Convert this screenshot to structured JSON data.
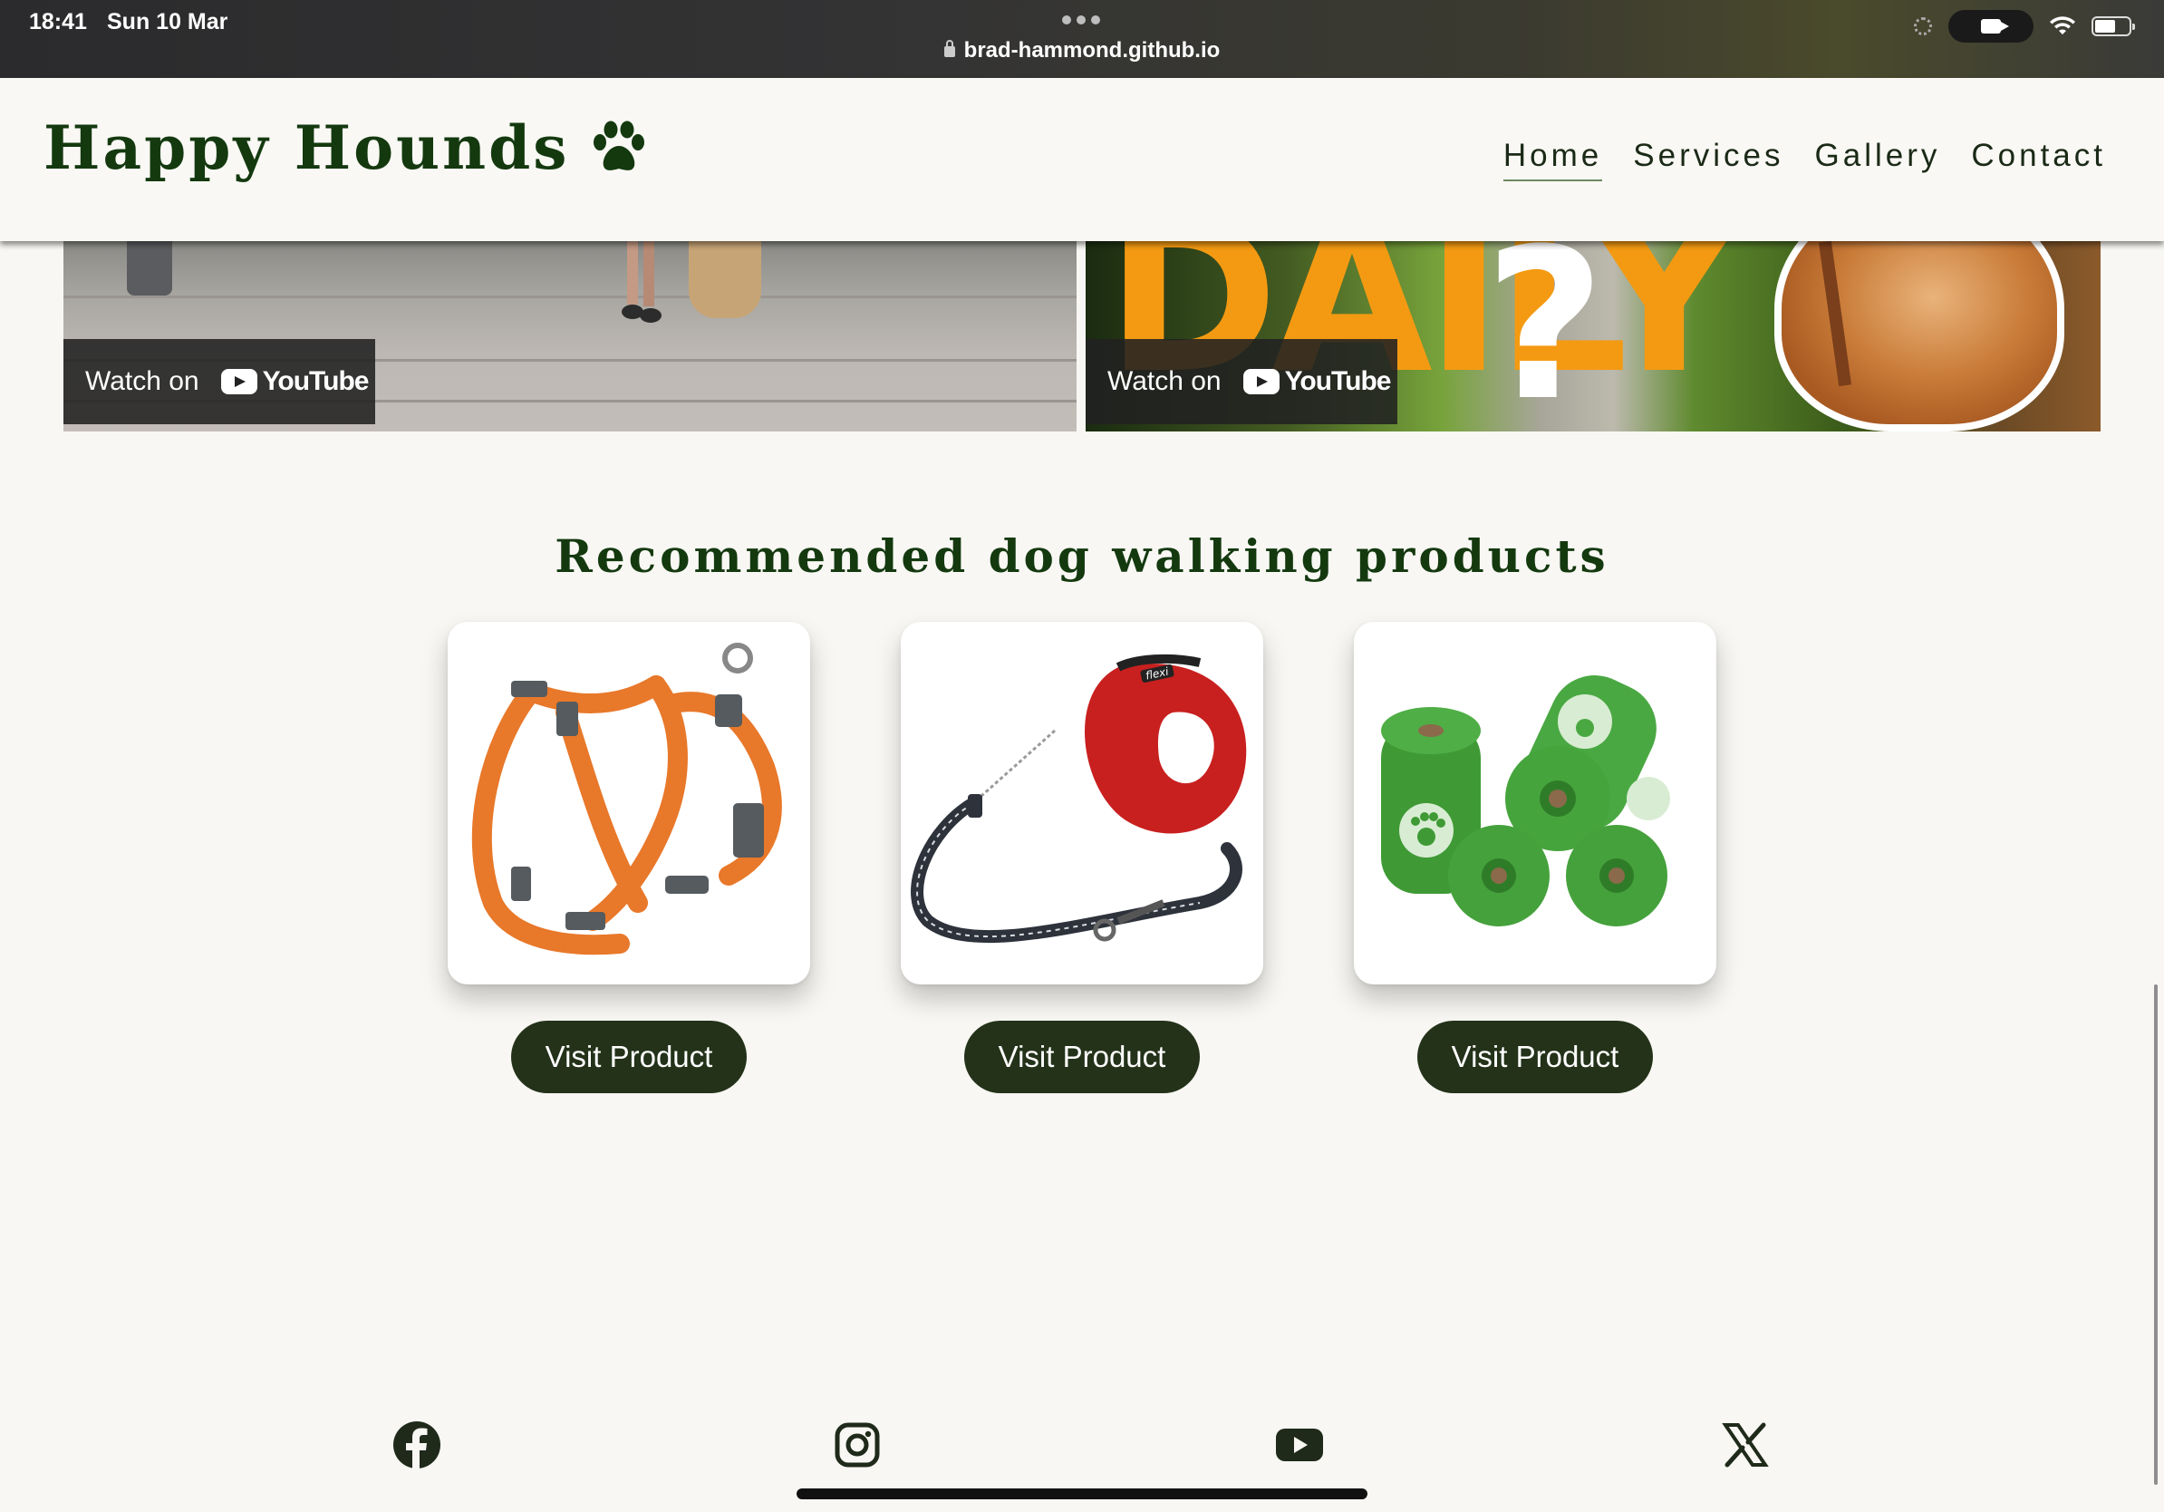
{
  "status_bar": {
    "time": "18:41",
    "date": "Sun 10 Mar",
    "url": "brad-hammond.github.io"
  },
  "header": {
    "logo_text": "Happy Hounds",
    "logo_icon": "paw-icon",
    "nav": [
      {
        "label": "Home",
        "active": true
      },
      {
        "label": "Services",
        "active": false
      },
      {
        "label": "Gallery",
        "active": false
      },
      {
        "label": "Contact",
        "active": false
      }
    ]
  },
  "videos": [
    {
      "watch_label": "Watch on",
      "platform": "YouTube"
    },
    {
      "watch_label": "Watch on",
      "platform": "YouTube",
      "overlay_text": "DAILY",
      "overlay_mark": "?"
    }
  ],
  "products_section": {
    "title": "Recommended dog walking products",
    "items": [
      {
        "image": "orange-dog-harness",
        "button": "Visit Product"
      },
      {
        "image": "red-retractable-leash",
        "button": "Visit Product",
        "brand_mark": "flexi"
      },
      {
        "image": "green-poop-bag-rolls",
        "button": "Visit Product"
      }
    ]
  },
  "footer": {
    "social_icons": [
      "facebook-icon",
      "instagram-icon",
      "youtube-icon",
      "x-icon"
    ]
  },
  "colors": {
    "brand_green": "#14390f",
    "button_bg": "#233219",
    "page_bg": "#f8f7f3"
  }
}
